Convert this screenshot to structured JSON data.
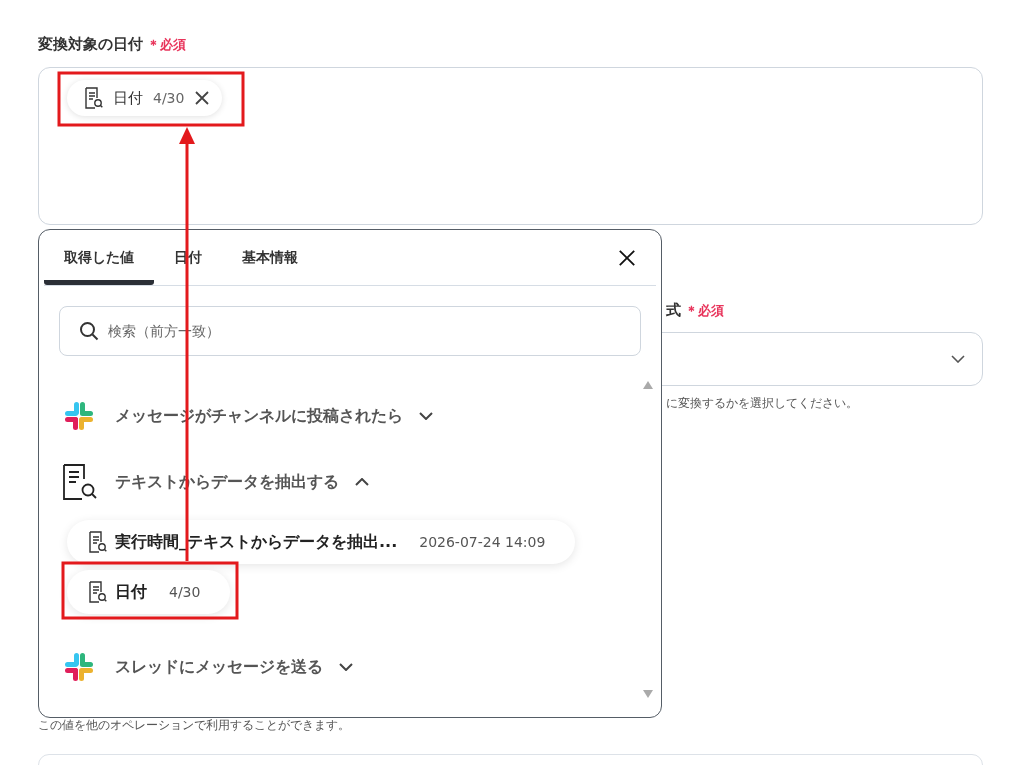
{
  "fields": [
    {
      "label": "変換対象の日付",
      "required_mark": "＊",
      "required": "必須",
      "chips": [
        {
          "label": "日付",
          "count": "4/30"
        }
      ]
    },
    {
      "label": "式",
      "required_mark": "＊",
      "required": "必須",
      "help": "に変換するかを選択してください。"
    }
  ],
  "footer_help": "この値を他のオペレーションで利用することができます。",
  "popup": {
    "tabs": [
      {
        "label": "取得した値",
        "selected": true
      },
      {
        "label": "日付",
        "selected": false
      },
      {
        "label": "基本情報",
        "selected": false
      }
    ],
    "search": {
      "placeholder": "検索（前方一致）"
    },
    "groups": [
      {
        "kind": "slack",
        "title": "メッセージがチャンネルに投稿されたら",
        "expanded": false
      },
      {
        "kind": "document",
        "title": "テキストからデータを抽出する",
        "expanded": true,
        "items": [
          {
            "label": "実行時間_テキストからデータを抽出...",
            "value": "2026-07-24 14:09"
          },
          {
            "label": "日付",
            "value": "4/30"
          }
        ]
      },
      {
        "kind": "slack",
        "title": "スレッドにメッセージを送る",
        "expanded": false
      }
    ]
  },
  "annotations": [
    {
      "kind": "box"
    },
    {
      "kind": "box"
    },
    {
      "kind": "arrow"
    }
  ]
}
